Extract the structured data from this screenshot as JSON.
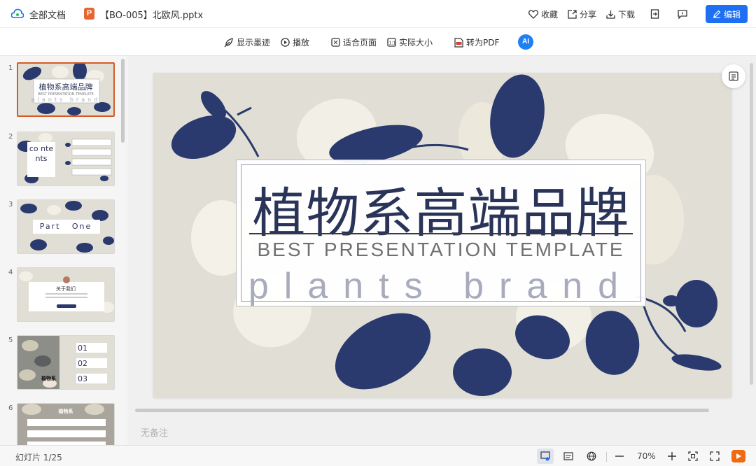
{
  "topbar": {
    "all_docs": "全部文档",
    "file_badge": "P",
    "file_name": "【BO-005】北欧风.pptx",
    "favorite": "收藏",
    "share": "分享",
    "download": "下载",
    "edit": "编辑"
  },
  "toolbar": {
    "show_ink": "显示墨迹",
    "play": "播放",
    "fit_page": "适合页面",
    "actual_size": "实际大小",
    "to_pdf": "转为PDF",
    "ai_label": "AI"
  },
  "thumbnails": [
    {
      "num": "1",
      "title": "植物系高端品牌",
      "sub": "BEST PRESENTATION TEMPLATE",
      "brand": "plants brand"
    },
    {
      "num": "2",
      "title": "co nte nts"
    },
    {
      "num": "3",
      "title": "Part   One"
    },
    {
      "num": "4",
      "title": "关于我们"
    },
    {
      "num": "5",
      "title": "01",
      "title2": "02",
      "title3": "03",
      "caption": "植物系"
    },
    {
      "num": "6",
      "title": "植物系"
    }
  ],
  "slide": {
    "title": "植物系高端品牌",
    "subtitle": "BEST PRESENTATION TEMPLATE",
    "brand": "plants brand"
  },
  "notes_placeholder": "无备注",
  "status": {
    "slide_count": "幻灯片 1/25",
    "zoom": "70%"
  },
  "colors": {
    "accent": "#1f6ff3",
    "slide_bg": "#e1dfd5",
    "leaf_navy": "#2a3a6e",
    "leaf_cream": "#f2efe6",
    "active_thumb_border": "#d85b23"
  }
}
